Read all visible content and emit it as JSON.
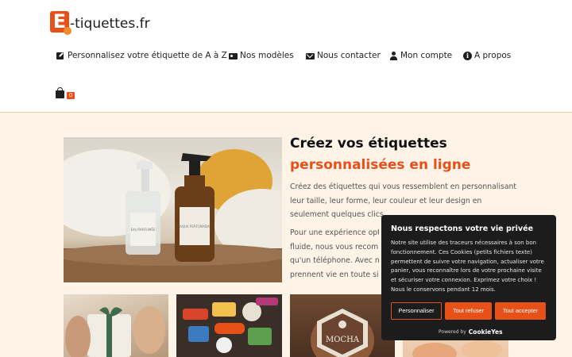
{
  "header": {
    "logo_letter": "E",
    "logo_text": "-tiquettes.fr",
    "nav": [
      {
        "label": "Personnalisez votre étiquette de A à Z",
        "icon": "edit-icon"
      },
      {
        "label": "Nos modèles",
        "icon": "id-card-icon"
      },
      {
        "label": "Nous contacter",
        "icon": "envelope-icon"
      },
      {
        "label": "Mon compte",
        "icon": "user-icon"
      },
      {
        "label": "A propos",
        "icon": "info-icon"
      }
    ],
    "cart": {
      "icon": "shopping-bag-icon",
      "count": "0"
    }
  },
  "hero": {
    "title_line1": "Créez vos étiquettes",
    "title_line2": "personnalisées en ligne",
    "paragraph1": "Créez des étiquettes qui vous ressemblent en personnalisant leur taille, leur forme, leur couleur et leur design en seulement quelques clics.",
    "paragraph2_lines": [
      "Pour une expérience optim",
      "fluide, nous vous recomma",
      "qu'un téléphone. Avec notr",
      "prennent vie en toute simpl"
    ],
    "bottle_label_1": "EAU PARFUMÉE",
    "bottle_label_2": "AQUA PERFUMADA"
  },
  "thumbnails": [
    {
      "name": "gift-wrap-photo",
      "caption": ""
    },
    {
      "name": "stickers-photo",
      "caption": ""
    },
    {
      "name": "mocha-label-photo",
      "caption": "MOCHA"
    },
    {
      "name": "pastry-photo",
      "caption": ""
    }
  ],
  "cookie_banner": {
    "title": "Nous respectons votre vie privée",
    "text": "Notre site utilise des traceurs nécessaires à son bon fonctionnement. Ces Cookies (petits fichiers texte) permettent de suivre votre navigation, actualiser votre panier, vous reconnaître lors de votre prochaine visite et sécuriser votre connexion. Exprimez votre choix ! Nous le conservons pendant 12 mois.",
    "buttons": {
      "customize": "Personnaliser",
      "refuse": "Tout refuser",
      "accept": "Tout accepter"
    },
    "powered_by": "Powered by",
    "brand": "CookieYes"
  },
  "colors": {
    "accent": "#e8501a",
    "background": "#fdf3e7",
    "banner": "#1c1c1c"
  }
}
